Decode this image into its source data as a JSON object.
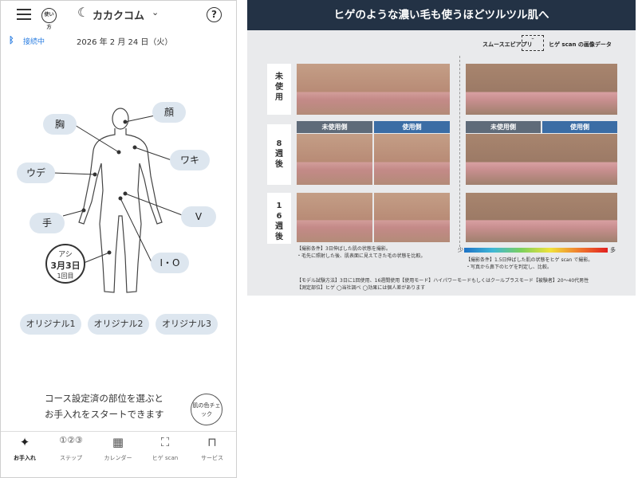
{
  "header": {
    "usage_label": "使い方",
    "app_name": "カカクコム",
    "help_label": "?"
  },
  "status": {
    "connection": "接続中",
    "date": "2026 年 2 月 24 日（火）"
  },
  "body_parts": {
    "face": "顔",
    "chest": "胸",
    "armpit": "ワキ",
    "arm": "ウデ",
    "hand": "手",
    "v": "V",
    "io": "I・O",
    "leg_label": "アシ",
    "leg_date": "3月3日",
    "leg_count": "1回目"
  },
  "originals": [
    "オリジナル1",
    "オリジナル2",
    "オリジナル3"
  ],
  "guide": {
    "line1": "コース設定済の部位を選ぶと",
    "line2": "お手入れをスタートできます",
    "skin_check": "肌の色チェック"
  },
  "tabs": [
    {
      "label": "お手入れ",
      "icon": "sparkle-icon",
      "active": true
    },
    {
      "label": "ステップ",
      "icon": "steps-icon",
      "active": false
    },
    {
      "label": "カレンダー",
      "icon": "calendar-icon",
      "active": false
    },
    {
      "label": "ヒゲ scan",
      "icon": "scan-icon",
      "active": false
    },
    {
      "label": "サービス",
      "icon": "gift-icon",
      "active": false
    }
  ],
  "promo": {
    "banner": "ヒゲのような濃い毛も使うほどツルツル肌へ",
    "app_label": "スムースエピアプリ",
    "scan_label": "ヒゲ scan の画像データ",
    "stage_unused": "未使用",
    "stage_8": "8週後",
    "stage_16": "16週後",
    "side_unused": "未使用側",
    "side_used": "使用側",
    "cond_photo_1": "【撮影条件】3日伸ばした肌の状態を撮影。",
    "cond_photo_2": "・毛先に照射した後、肌表面に見えてきた毛の状態を比較。",
    "cond_scan_1": "【撮影条件】1.5日伸ばした肌の状態をヒゲ scan で撮影。",
    "cond_scan_2": "・写真から鼻下のヒゲを判定し、比較。",
    "scale_low": "少",
    "scale_high": "多",
    "model_1": "【モデル試験方法】3日に1回使用、16週間使用【使用モード】ハイパワーモードもしくはクールプラスモード【被験者】20～40代男性",
    "model_2": "【測定部位】ヒゲ ◯当社調べ ◯効果には個人差があります"
  }
}
